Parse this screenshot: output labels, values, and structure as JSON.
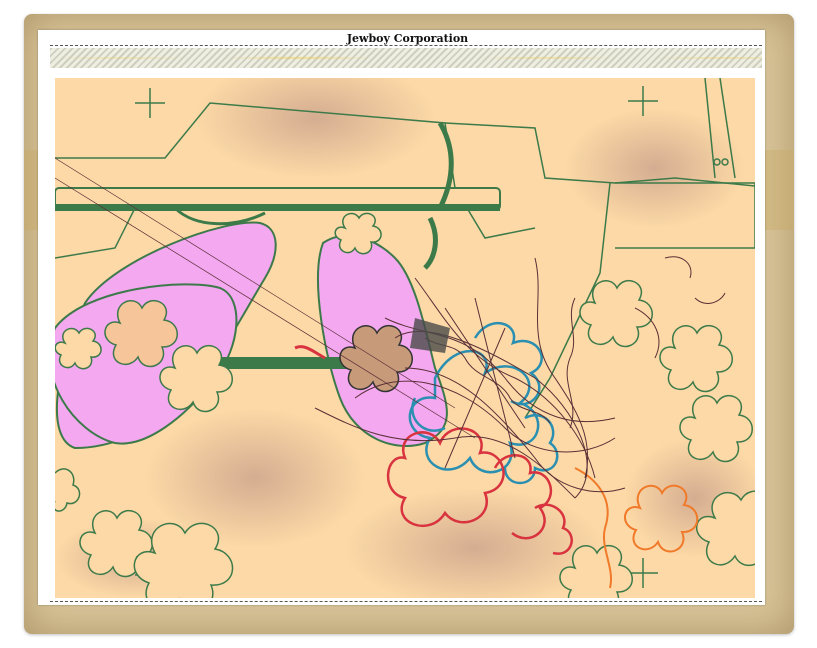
{
  "header": {
    "title": "Jewboy Corporation"
  },
  "artwork": {
    "colors": {
      "background": "#fcd9a6",
      "outline_green": "#3d7a4a",
      "pink": "#f3a8f0",
      "blue": "#2a8fb0",
      "red": "#d8333f",
      "orange": "#f07a2a",
      "ink": "#5a2f36"
    }
  }
}
